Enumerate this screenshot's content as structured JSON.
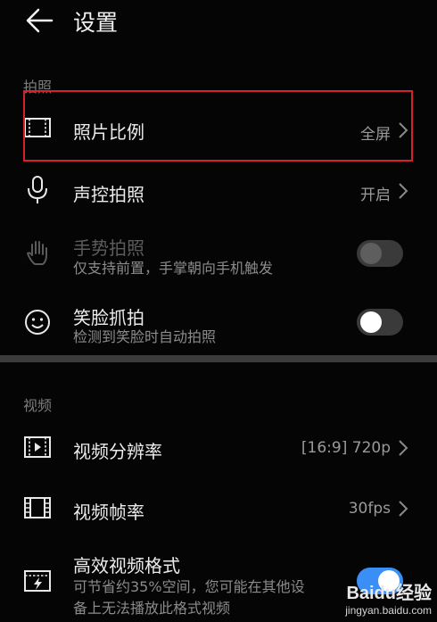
{
  "header": {
    "title": "设置"
  },
  "sections": {
    "photo_label": "拍照",
    "video_label": "视频"
  },
  "rows": {
    "photo_ratio": {
      "title": "照片比例",
      "value": "全屏"
    },
    "voice_capture": {
      "title": "声控拍照",
      "value": "开启"
    },
    "gesture_capture": {
      "title": "手势拍照",
      "subtitle": "仅支持前置，手掌朝向手机触发",
      "enabled": false,
      "toggle_on": false
    },
    "smile_capture": {
      "title": "笑脸抓拍",
      "subtitle": "检测到笑脸时自动拍照",
      "toggle_on": false
    },
    "video_resolution": {
      "title": "视频分辨率",
      "value": "[16:9] 720p"
    },
    "video_framerate": {
      "title": "视频帧率",
      "value": "30fps"
    },
    "efficient_format": {
      "title": "高效视频格式",
      "subtitle_line1": "可节省约35%空间，您可能在其他设",
      "subtitle_line2": "备上无法播放此格式视频",
      "toggle_on": true
    }
  },
  "watermark": {
    "logo": "Baidu经验",
    "url": "jingyan.baidu.com"
  },
  "icons": [
    "back-arrow-icon",
    "aspect-ratio-icon",
    "microphone-icon",
    "hand-icon",
    "smile-icon",
    "video-resolution-icon",
    "film-icon",
    "hevc-format-icon",
    "chevron-right-icon"
  ],
  "colors": {
    "background": "#050505",
    "highlight": "#d6202b",
    "toggle_on": "#3a8ff7",
    "toggle_off": "#3a3a3a"
  }
}
